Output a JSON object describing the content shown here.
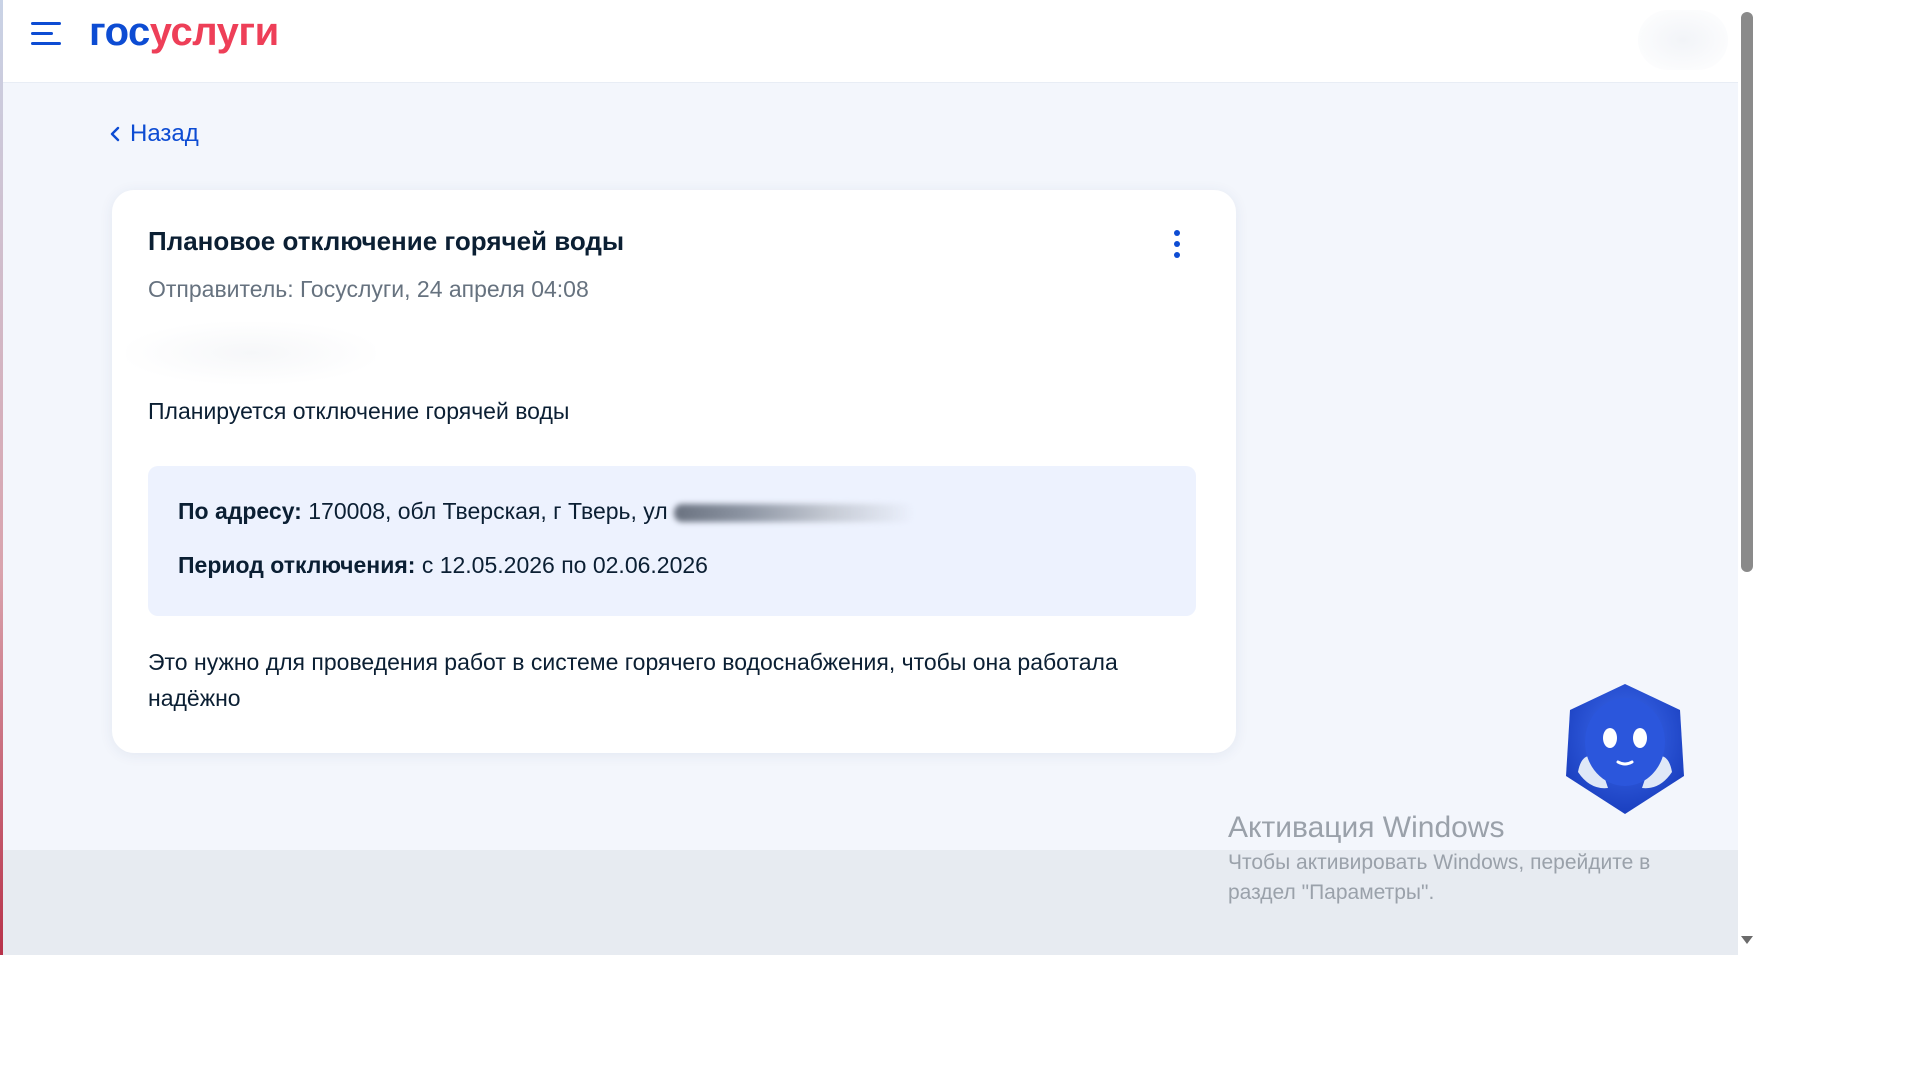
{
  "header": {
    "logo_part1": "гос",
    "logo_part2": "услуги",
    "brand_blue": "#0d4cd3",
    "brand_red": "#ee3f58"
  },
  "nav": {
    "back_label": "Назад"
  },
  "message": {
    "title": "Плановое отключение горячей воды",
    "meta": "Отправитель: Госуслуги, 24 апреля 04:08",
    "lead": "Планируется отключение горячей воды",
    "address_label": "По адресу:",
    "address_value": "170008, обл Тверская, г Тверь, ул",
    "period_label": "Период отключения:",
    "period_value": "с 12.05.2026 по 02.06.2026",
    "note": "Это нужно для проведения работ в системе горячего водоснабжения, чтобы она работала надёжно"
  },
  "watermark": {
    "title": "Активация Windows",
    "text": "Чтобы активировать Windows, перейдите в раздел \"Параметры\"."
  },
  "icons": {
    "menu": "menu-icon",
    "back": "chevron-left-icon",
    "more": "kebab-icon",
    "assistant": "robot-assistant-icon"
  }
}
